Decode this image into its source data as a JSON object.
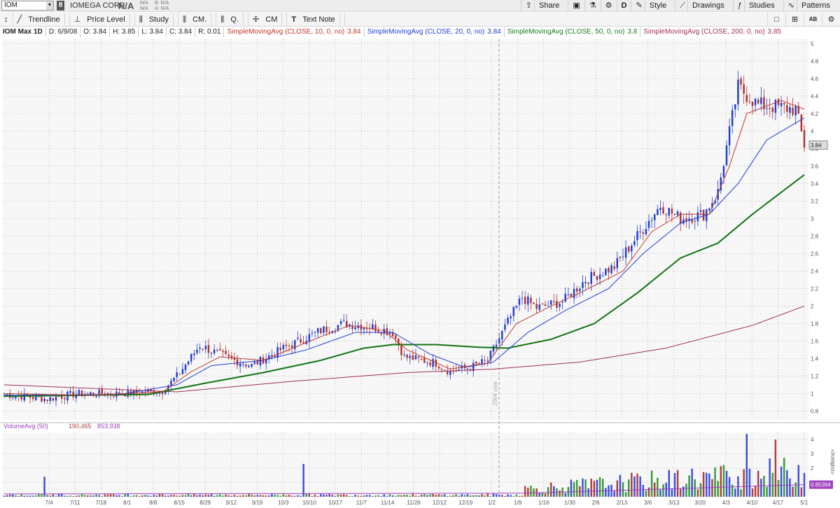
{
  "header": {
    "symbol": "IOM",
    "badge": "8",
    "company": "IOMEGA CORP",
    "price": "N/A",
    "bid_left": "N/A",
    "ask_left": "N/A",
    "bid": "B: N/A",
    "ask": "A: N/A",
    "buttons": [
      "Share",
      "Style",
      "Drawings",
      "Studies",
      "Patterns"
    ],
    "period": "D"
  },
  "toolbar": {
    "tools": [
      "Trendline",
      "Price Level",
      "Study",
      "CM.",
      "Q.",
      "CM",
      "Text Note"
    ],
    "right": [
      "AB"
    ]
  },
  "legend": {
    "title": "IOM Max 1D",
    "date": "D: 6/9/08",
    "open": "O: 3.84",
    "high": "H: 3.85",
    "low": "L: 3.84",
    "close": "C: 3.84",
    "range": "R: 0.01",
    "studies": [
      {
        "label": "SimpleMovingAvg (CLOSE, 10, 0, no)",
        "value": "3.84",
        "color": "#c0392b"
      },
      {
        "label": "SimpleMovingAvg (CLOSE, 20, 0, no)",
        "value": "3.84",
        "color": "#1f3fd1"
      },
      {
        "label": "SimpleMovingAvg (CLOSE, 50, 0, no)",
        "value": "3.8",
        "color": "#1a7a1a"
      },
      {
        "label": "SimpleMovingAvg (CLOSE, 200, 0, no)",
        "value": "3.85",
        "color": "#a0305a"
      }
    ]
  },
  "volume_legend": {
    "label": "VolumeAvg (50)",
    "value1": "190,465",
    "value2": "853,938"
  },
  "colors": {
    "up": "#1f3fd1",
    "down": "#b03030",
    "sma10": "#c0392b",
    "sma20": "#1f3fd1",
    "sma50": "#137313",
    "sma200": "#a0305a"
  },
  "chart_data": {
    "type": "candlestick",
    "yticks": [
      0.8,
      1,
      1.2,
      1.4,
      1.6,
      1.8,
      2,
      2.2,
      2.4,
      2.6,
      2.8,
      3,
      3.2,
      3.4,
      3.6,
      3.8,
      4,
      4.2,
      4.4,
      4.6,
      4.8,
      5
    ],
    "ylim": [
      0.7,
      5.05
    ],
    "last_price": "3.84",
    "xticks": [
      "7/4",
      "7/11",
      "7/18",
      "8/1",
      "8/8",
      "8/15",
      "8/29",
      "9/12",
      "9/19",
      "10/3",
      "10/10",
      "10/17",
      "11/7",
      "11/14",
      "11/28",
      "12/12",
      "12/19",
      "1/2",
      "1/9",
      "1/16",
      "1/30",
      "2/6",
      "2/13",
      "3/6",
      "3/13",
      "3/20",
      "4/3",
      "4/10",
      "4/17",
      "5/1"
    ],
    "year_label": "2004 year",
    "price_keypoints": [
      [
        0,
        0.99
      ],
      [
        15,
        0.94
      ],
      [
        25,
        1.0
      ],
      [
        40,
        1.0
      ],
      [
        55,
        1.03
      ],
      [
        60,
        1.2
      ],
      [
        68,
        1.55
      ],
      [
        78,
        1.4
      ],
      [
        86,
        1.32
      ],
      [
        96,
        1.5
      ],
      [
        110,
        1.72
      ],
      [
        118,
        1.8
      ],
      [
        128,
        1.76
      ],
      [
        135,
        1.7
      ],
      [
        139,
        1.42
      ],
      [
        150,
        1.35
      ],
      [
        155,
        1.25
      ],
      [
        162,
        1.3
      ],
      [
        168,
        1.38
      ],
      [
        175,
        1.82
      ],
      [
        180,
        2.1
      ],
      [
        185,
        1.98
      ],
      [
        194,
        2.05
      ],
      [
        202,
        2.3
      ],
      [
        212,
        2.45
      ],
      [
        220,
        2.8
      ],
      [
        228,
        3.15
      ],
      [
        235,
        3.0
      ],
      [
        243,
        3.05
      ],
      [
        248,
        3.3
      ],
      [
        255,
        4.5
      ],
      [
        262,
        4.3
      ],
      [
        275,
        4.25
      ],
      [
        278,
        3.84
      ]
    ],
    "sma10_keypoints": [
      [
        0,
        1.0
      ],
      [
        30,
        0.98
      ],
      [
        55,
        1.02
      ],
      [
        65,
        1.25
      ],
      [
        75,
        1.42
      ],
      [
        90,
        1.38
      ],
      [
        110,
        1.65
      ],
      [
        120,
        1.78
      ],
      [
        132,
        1.72
      ],
      [
        140,
        1.5
      ],
      [
        155,
        1.28
      ],
      [
        168,
        1.35
      ],
      [
        178,
        1.8
      ],
      [
        190,
        2.0
      ],
      [
        200,
        2.15
      ],
      [
        215,
        2.4
      ],
      [
        225,
        2.85
      ],
      [
        235,
        3.05
      ],
      [
        245,
        3.05
      ],
      [
        252,
        3.6
      ],
      [
        258,
        4.2
      ],
      [
        270,
        4.35
      ],
      [
        278,
        4.25
      ]
    ],
    "sma20_keypoints": [
      [
        0,
        0.98
      ],
      [
        40,
        0.99
      ],
      [
        60,
        1.1
      ],
      [
        72,
        1.32
      ],
      [
        90,
        1.38
      ],
      [
        105,
        1.5
      ],
      [
        122,
        1.7
      ],
      [
        135,
        1.7
      ],
      [
        148,
        1.45
      ],
      [
        160,
        1.3
      ],
      [
        170,
        1.36
      ],
      [
        182,
        1.7
      ],
      [
        195,
        1.95
      ],
      [
        210,
        2.2
      ],
      [
        222,
        2.6
      ],
      [
        235,
        2.95
      ],
      [
        245,
        3.05
      ],
      [
        255,
        3.4
      ],
      [
        265,
        3.9
      ],
      [
        278,
        4.15
      ]
    ],
    "sma50_keypoints": [
      [
        0,
        0.97
      ],
      [
        50,
        0.99
      ],
      [
        70,
        1.12
      ],
      [
        90,
        1.24
      ],
      [
        110,
        1.38
      ],
      [
        125,
        1.52
      ],
      [
        135,
        1.56
      ],
      [
        150,
        1.56
      ],
      [
        165,
        1.53
      ],
      [
        175,
        1.52
      ],
      [
        190,
        1.62
      ],
      [
        205,
        1.8
      ],
      [
        220,
        2.15
      ],
      [
        235,
        2.55
      ],
      [
        248,
        2.72
      ],
      [
        260,
        3.05
      ],
      [
        278,
        3.5
      ]
    ],
    "sma200_keypoints": [
      [
        0,
        1.1
      ],
      [
        30,
        1.06
      ],
      [
        60,
        1.02
      ],
      [
        100,
        1.14
      ],
      [
        140,
        1.24
      ],
      [
        170,
        1.28
      ],
      [
        200,
        1.36
      ],
      [
        230,
        1.52
      ],
      [
        260,
        1.78
      ],
      [
        278,
        2.0
      ]
    ],
    "volume_ylim": [
      0,
      4.5
    ],
    "volume_yticks": [
      1,
      2,
      3,
      4
    ],
    "volume_unit": "<millions>",
    "volume_last": "0.85394"
  }
}
